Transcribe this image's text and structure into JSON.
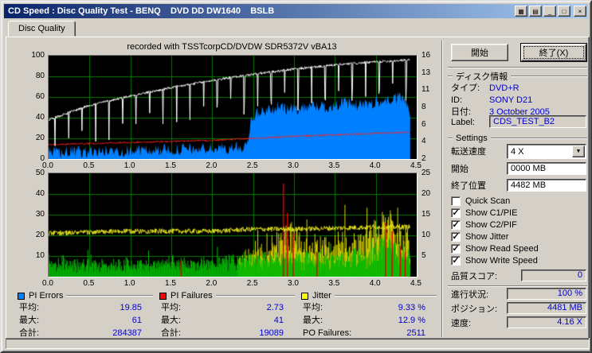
{
  "window": {
    "title": "CD Speed : Disc Quality Test - BENQ    DVD DD DW1640    BSLB"
  },
  "titlebar": {
    "buttons": [
      {
        "name": "panel-1",
        "glyph": "▦"
      },
      {
        "name": "panel-2",
        "glyph": "▤"
      },
      {
        "name": "minimize",
        "glyph": "_"
      },
      {
        "name": "maximize",
        "glyph": "□"
      },
      {
        "name": "close",
        "glyph": "×"
      }
    ]
  },
  "tab": {
    "label": "Disc Quality"
  },
  "actions": {
    "start": "開始",
    "exit": "終了(X)"
  },
  "disc_info": {
    "title": "ディスク情報",
    "rows": [
      {
        "label": "タイプ:",
        "value": "DVD+R"
      },
      {
        "label": "ID:",
        "value": "SONY D21"
      },
      {
        "label": "日付:",
        "value": "3 October 2005"
      },
      {
        "label": "Label:",
        "value": "CDS_TEST_B2"
      }
    ]
  },
  "settings": {
    "title": "Settings",
    "speed_label": "転送速度",
    "speed_value": "4 X",
    "start_label": "開始",
    "start_value": "0000 MB",
    "end_label": "終了位置",
    "end_value": "4482 MB",
    "checkboxes": [
      {
        "label": "Quick Scan",
        "checked": false
      },
      {
        "label": "Show C1/PIE",
        "checked": true
      },
      {
        "label": "Show C2/PIF",
        "checked": true
      },
      {
        "label": "Show Jitter",
        "checked": true
      },
      {
        "label": "Show Read Speed",
        "checked": true
      },
      {
        "label": "Show Write Speed",
        "checked": true
      }
    ]
  },
  "quality": {
    "label": "品質スコア:",
    "value": "0"
  },
  "progress": [
    {
      "label": "進行状況:",
      "value": "100 %"
    },
    {
      "label": "ポジション:",
      "value": "4481 MB"
    },
    {
      "label": "速度:",
      "value": "4.16 X"
    }
  ],
  "legends": [
    {
      "title": "PI Errors",
      "color": "#0080FF",
      "rows": [
        {
          "label": "平均:",
          "value": "19.85"
        },
        {
          "label": "最大:",
          "value": "61"
        },
        {
          "label": "合計:",
          "value": "284387"
        }
      ]
    },
    {
      "title": "PI Failures",
      "color": "#FF0000",
      "rows": [
        {
          "label": "平均:",
          "value": "2.73"
        },
        {
          "label": "最大:",
          "value": "41"
        },
        {
          "label": "合計:",
          "value": "19089"
        }
      ]
    },
    {
      "title": "Jitter",
      "color": "#FFFF00",
      "rows": [
        {
          "label": "平均:",
          "value": "9.33 %"
        },
        {
          "label": "最大:",
          "value": "12.9 %"
        },
        {
          "label": "PO Failures:",
          "value": "2511"
        }
      ]
    }
  ],
  "chart_data": [
    {
      "type": "area",
      "title": "recorded with TSSTcorpCD/DVDW SDR5372V vBA13",
      "x": {
        "range": [
          0,
          4.5
        ],
        "ticks": [
          "0.0",
          "0.5",
          "1.0",
          "1.5",
          "2.0",
          "2.5",
          "3.0",
          "3.5",
          "4.0",
          "4.5"
        ],
        "unit": "GB"
      },
      "y_left": {
        "range": [
          0,
          100
        ],
        "ticks": [
          "0",
          "20",
          "40",
          "60",
          "80",
          "100"
        ]
      },
      "y_right": {
        "ticks": [
          "16",
          "13",
          "11",
          "8",
          "6",
          "4",
          "2"
        ]
      },
      "grid": true,
      "series": [
        {
          "name": "PI Errors",
          "type": "area",
          "color": "#0080FF",
          "noise": 6,
          "points": [
            [
              0,
              6
            ],
            [
              0.5,
              7
            ],
            [
              1,
              8
            ],
            [
              1.5,
              9
            ],
            [
              2,
              10
            ],
            [
              2.35,
              11
            ],
            [
              2.42,
              13
            ],
            [
              2.48,
              40
            ],
            [
              2.6,
              46
            ],
            [
              2.8,
              50
            ],
            [
              3,
              48
            ],
            [
              3.2,
              52
            ],
            [
              3.4,
              50
            ],
            [
              3.6,
              54
            ],
            [
              3.8,
              52
            ],
            [
              4,
              55
            ],
            [
              4.2,
              57
            ],
            [
              4.35,
              60
            ],
            [
              4.42,
              40
            ]
          ],
          "stats": {
            "avg": 19.85,
            "max": 61,
            "total": 284387
          }
        },
        {
          "name": "Read Speed",
          "type": "line",
          "color": "#FF2020",
          "noise": 0.8,
          "points": [
            [
              0,
              14
            ],
            [
              1,
              16
            ],
            [
              2,
              18
            ],
            [
              2.5,
              20
            ],
            [
              3,
              22
            ],
            [
              3.7,
              24
            ],
            [
              4.42,
              26
            ]
          ],
          "stats": {
            "avg_speed": "4.16 X"
          }
        },
        {
          "name": "Write Speed",
          "type": "line-dips",
          "color": "#FFFFFF",
          "noise": 1.2,
          "dips": {
            "start": 0.08,
            "interval": 0.165,
            "depth": [
              18,
              40
            ]
          },
          "points": [
            [
              0,
              38
            ],
            [
              0.5,
              52
            ],
            [
              1,
              61
            ],
            [
              1.5,
              69
            ],
            [
              2,
              76
            ],
            [
              2.5,
              82
            ],
            [
              3,
              87
            ],
            [
              3.5,
              91
            ],
            [
              4,
              94
            ],
            [
              4.42,
              96
            ]
          ]
        }
      ]
    },
    {
      "type": "spikes",
      "x": {
        "range": [
          0,
          4.5
        ],
        "ticks": [
          "0.0",
          "0.5",
          "1.0",
          "1.5",
          "2.0",
          "2.5",
          "3.0",
          "3.5",
          "4.0",
          "4.5"
        ],
        "unit": "GB"
      },
      "y_left": {
        "range": [
          0,
          50
        ],
        "ticks": [
          "10",
          "20",
          "30",
          "40",
          "50"
        ]
      },
      "y_right": {
        "ticks": [
          "25",
          "20",
          "15",
          "10",
          "5"
        ]
      },
      "grid": true,
      "series": [
        {
          "name": "Jitter peaks",
          "type": "spikes",
          "color": "#D8D800",
          "noise": 8,
          "points": [
            [
              0,
              0
            ],
            [
              2.3,
              0
            ],
            [
              2.45,
              5
            ],
            [
              2.6,
              8
            ],
            [
              2.8,
              12
            ],
            [
              2.9,
              20
            ],
            [
              3,
              14
            ],
            [
              3.2,
              9
            ],
            [
              3.4,
              9
            ],
            [
              3.6,
              11
            ],
            [
              3.8,
              13
            ],
            [
              4,
              16
            ],
            [
              4.15,
              20
            ],
            [
              4.3,
              18
            ],
            [
              4.42,
              10
            ]
          ]
        },
        {
          "name": "PI Failures",
          "type": "spikes",
          "color": "#00B800",
          "noise": 4,
          "points": [
            [
              0,
              4
            ],
            [
              0.5,
              4
            ],
            [
              1,
              4.5
            ],
            [
              1.5,
              4.5
            ],
            [
              2,
              5
            ],
            [
              2.5,
              6
            ],
            [
              3,
              7
            ],
            [
              3.5,
              7
            ],
            [
              3.8,
              9
            ],
            [
              4,
              11
            ],
            [
              4.15,
              13
            ],
            [
              4.3,
              12
            ],
            [
              4.42,
              8
            ]
          ],
          "stats": {
            "avg": 2.73,
            "max": 41,
            "total": 19089
          }
        },
        {
          "name": "PO Failures",
          "type": "vlines",
          "color": "#E00000",
          "points": [
            [
              1.62,
              8
            ],
            [
              2.87,
              45
            ],
            [
              2.92,
              31
            ],
            [
              2.99,
              21
            ],
            [
              3.28,
              12
            ],
            [
              4.12,
              26
            ],
            [
              4.2,
              22
            ],
            [
              4.3,
              15
            ],
            [
              4.36,
              12
            ]
          ],
          "stats": {
            "total": 2511
          }
        },
        {
          "name": "Jitter",
          "type": "line",
          "color": "#E8E820",
          "noise": 1.2,
          "points": [
            [
              0,
              21
            ],
            [
              1,
              22
            ],
            [
              2,
              22
            ],
            [
              2.5,
              23
            ],
            [
              3,
              23
            ],
            [
              3.5,
              23.5
            ],
            [
              4,
              24
            ],
            [
              4.42,
              24
            ]
          ],
          "stats": {
            "avg": "9.33 %",
            "max": "12.9 %"
          }
        }
      ]
    }
  ]
}
